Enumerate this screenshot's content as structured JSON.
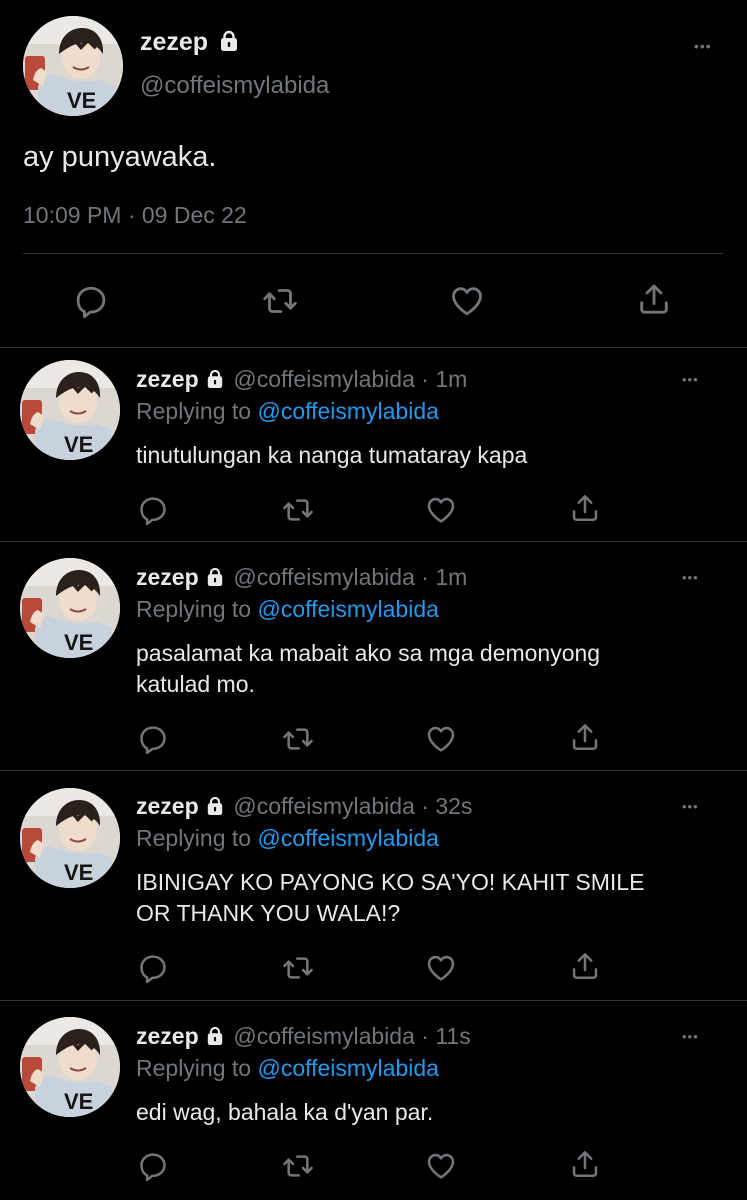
{
  "main_tweet": {
    "display_name": "zezep",
    "handle": "@coffeismylabida",
    "text": "ay punyawaka.",
    "timestamp": "10:09 PM · 09 Dec 22"
  },
  "replies": [
    {
      "display_name": "zezep",
      "handle": "@coffeismylabida",
      "time": "· 1m",
      "replying_label": "Replying to",
      "replying_to": "@coffeismylabida",
      "text": [
        "tinutulungan ka nanga tumataray kapa"
      ]
    },
    {
      "display_name": "zezep",
      "handle": "@coffeismylabida",
      "time": "· 1m",
      "replying_label": "Replying to",
      "replying_to": "@coffeismylabida",
      "text": [
        "pasalamat ka mabait ako sa mga demonyong",
        "katulad mo."
      ]
    },
    {
      "display_name": "zezep",
      "handle": "@coffeismylabida",
      "time": "· 32s",
      "replying_label": "Replying to",
      "replying_to": "@coffeismylabida",
      "text": [
        "IBINIGAY KO PAYONG KO SA'YO! KAHIT SMILE",
        "OR THANK YOU WALA!?"
      ]
    },
    {
      "display_name": "zezep",
      "handle": "@coffeismylabida",
      "time": "· 11s",
      "replying_label": "Replying to",
      "replying_to": "@coffeismylabida",
      "text": [
        "edi wag, bahala ka d'yan par."
      ]
    }
  ],
  "more_label": "•••",
  "colors": {
    "background": "#000000",
    "primary_text": "#e7e9ea",
    "secondary_text": "#71767b",
    "link": "#1d9bf0",
    "divider": "#2f3336"
  },
  "icons": {
    "lock": "lock-icon",
    "more": "more-icon",
    "reply": "reply-icon",
    "retweet": "retweet-icon",
    "like": "like-icon",
    "share": "share-icon"
  }
}
